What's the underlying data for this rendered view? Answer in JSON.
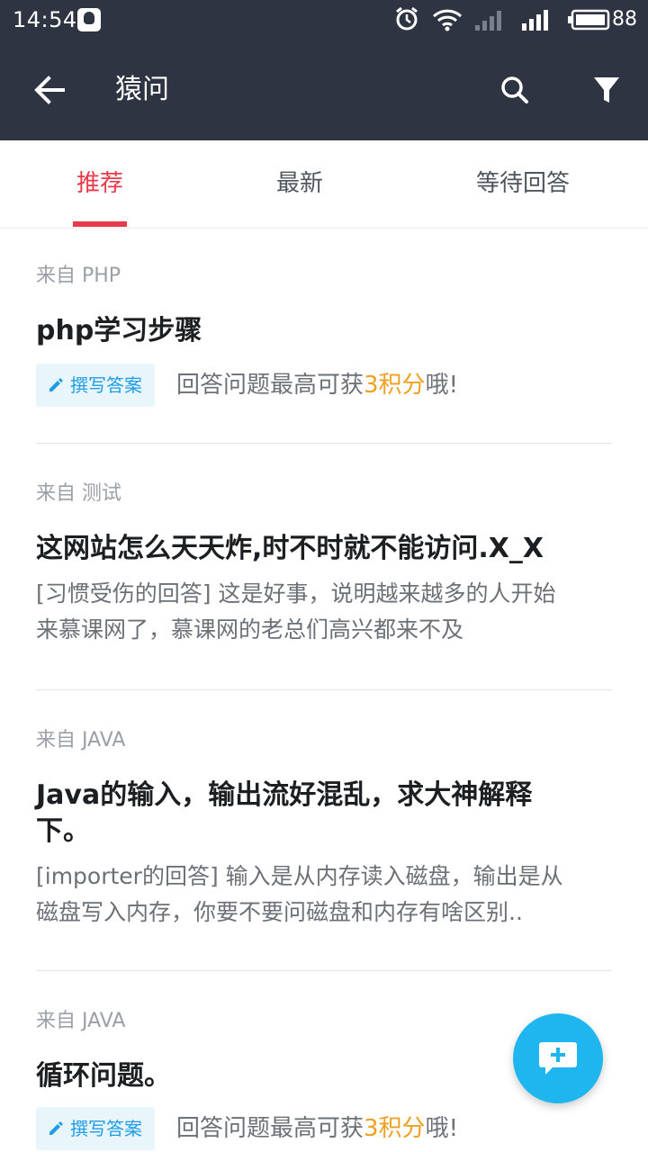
{
  "status_bar": {
    "time": "14:54",
    "battery": "88"
  },
  "app_bar": {
    "title": "猿问"
  },
  "tabs": [
    {
      "label": "推荐"
    },
    {
      "label": "最新"
    },
    {
      "label": "等待回答"
    }
  ],
  "feed": [
    {
      "source": "来自 PHP",
      "title": "php学习步骤",
      "write_label": "撰写答案",
      "reward_prefix": "回答问题最高可获",
      "reward_points": "3积分",
      "reward_suffix": "哦!"
    },
    {
      "source": "来自 测试",
      "title": "这网站怎么天天炸,时不时就不能访问.X_X",
      "snippet_line1": "[习惯受伤的回答] 这是好事，说明越来越多的人开始",
      "snippet_line2": "来慕课网了，慕课网的老总们高兴都来不及"
    },
    {
      "source": "来自 JAVA",
      "title_line1": "Java的输入，输出流好混乱，求大神解释",
      "title_line2": "下。",
      "snippet_line1": "[importer的回答] 输入是从内存读入磁盘，输出是从",
      "snippet_line2": "磁盘写入内存，你要不要问磁盘和内存有啥区别.."
    },
    {
      "source": "来自 JAVA",
      "title": "循环问题。",
      "write_label": "撰写答案",
      "reward_prefix": "回答问题最高可获",
      "reward_points": "3积分",
      "reward_suffix": "哦!"
    }
  ],
  "colors": {
    "appbar": "#2f3442",
    "accent_red": "#e63b4a",
    "accent_blue": "#1e9ce6",
    "points_orange": "#f0a020",
    "fab": "#1fb6ef"
  },
  "icons": [
    "qq-icon",
    "alarm-icon",
    "wifi-icon",
    "signal-icon",
    "battery-icon",
    "back-arrow-icon",
    "search-icon",
    "filter-icon",
    "pencil-icon",
    "add-question-icon"
  ]
}
